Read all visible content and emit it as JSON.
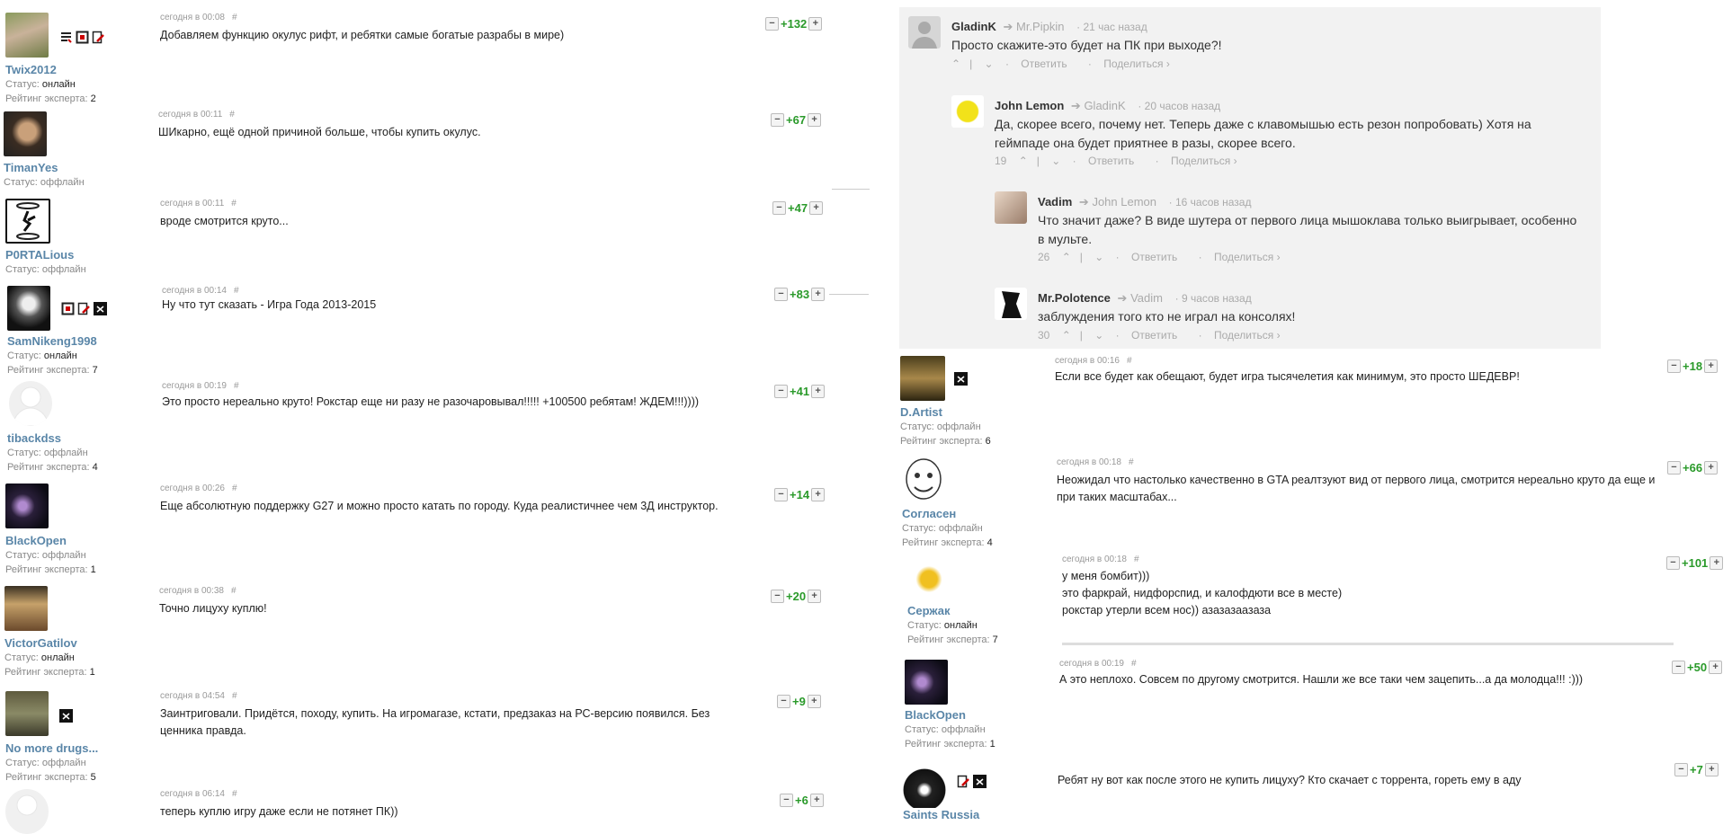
{
  "left_posts": [
    {
      "user": "Twix2012",
      "status_label": "Статус:",
      "status": "онлайн",
      "rating_label": "Рейтинг эксперта:",
      "rating": "2",
      "time": "сегодня в 00:08",
      "text": "Добавляем функцию окулус рифт, и ребятки самые богатые разрабы в мире)",
      "score": "+132"
    },
    {
      "user": "TimanYes",
      "status_label": "Статус:",
      "status": "оффлайн",
      "time": "сегодня в 00:11",
      "text": "ШИкарно, ещё одной причиной больше, чтобы купить окулус.",
      "score": "+67"
    },
    {
      "user": "P0RTALious",
      "status_label": "Статус:",
      "status": "оффлайн",
      "time": "сегодня в 00:11",
      "text": "вроде смотрится круто...",
      "score": "+47"
    },
    {
      "user": "SamNikeng1998",
      "status_label": "Статус:",
      "status": "онлайн",
      "rating_label": "Рейтинг эксперта:",
      "rating": "7",
      "time": "сегодня в 00:14",
      "text": "Ну что тут сказать - Игра Года 2013-2015",
      "score": "+83"
    },
    {
      "user": "tibackdss",
      "status_label": "Статус:",
      "status": "оффлайн",
      "rating_label": "Рейтинг эксперта:",
      "rating": "4",
      "time": "сегодня в 00:19",
      "text": "Это просто нереально круто! Рокстар еще ни разу не разочаровывал!!!!! +100500 ребятам! ЖДЕМ!!!))))",
      "score": "+41"
    },
    {
      "user": "BlackOpen",
      "status_label": "Статус:",
      "status": "оффлайн",
      "rating_label": "Рейтинг эксперта:",
      "rating": "1",
      "time": "сегодня в 00:26",
      "text": "Еще абсолютную поддержку G27 и можно просто катать по городу. Куда реалистичнее чем 3Д инструктор.",
      "score": "+14"
    },
    {
      "user": "VictorGatilov",
      "status_label": "Статус:",
      "status": "онлайн",
      "rating_label": "Рейтинг эксперта:",
      "rating": "1",
      "time": "сегодня в 00:38",
      "text": "Точно лицуху куплю!",
      "score": "+20"
    },
    {
      "user": "No more drugs...",
      "status_label": "Статус:",
      "status": "оффлайн",
      "rating_label": "Рейтинг эксперта:",
      "rating": "5",
      "time": "сегодня в 04:54",
      "text": "Заинтриговали. Придётся, походу, купить. На игромагазе, кстати, предзаказ на РС-версию появился. Без ценника правда.",
      "score": "+9"
    },
    {
      "time": "сегодня в 06:14",
      "text": "теперь куплю игру даже если не потянет ПК))",
      "score": "+6"
    }
  ],
  "hash": "#",
  "thread": [
    {
      "author": "GladinK",
      "reply_to": "Mr.Pipkin",
      "ago": "21 час назад",
      "text": "Просто скажите-это будет на ПК при выходе?!",
      "votes": "",
      "reply": "Ответить",
      "share": "Поделиться ›"
    },
    {
      "author": "John Lemon",
      "reply_to": "GladinK",
      "ago": "20 часов назад",
      "text": "Да, скорее всего, почему нет. Теперь даже с клавомышью есть резон попробовать) Хотя на геймпаде она будет приятнее в разы, скорее всего.",
      "votes": "19",
      "reply": "Ответить",
      "share": "Поделиться ›"
    },
    {
      "author": "Vadim",
      "reply_to": "John Lemon",
      "ago": "16 часов назад",
      "text": "Что значит даже? В виде шутера от первого лица мышоклава только выигрывает, особенно в мульте.",
      "votes": "26",
      "reply": "Ответить",
      "share": "Поделиться ›"
    },
    {
      "author": "Mr.Polotence",
      "reply_to": "Vadim",
      "ago": "9 часов назад",
      "text": "заблуждения того кто не играл на консолях!",
      "votes": "30",
      "reply": "Ответить",
      "share": "Поделиться ›"
    }
  ],
  "right_posts": [
    {
      "user": "D.Artist",
      "status_label": "Статус:",
      "status": "оффлайн",
      "rating_label": "Рейтинг эксперта:",
      "rating": "6",
      "time": "сегодня в 00:16",
      "text": "Если все будет как обещают, будет игра тысячелетия как минимум, это просто ШЕДЕВР!",
      "score": "+18"
    },
    {
      "user": "Согласен",
      "status_label": "Статус:",
      "status": "оффлайн",
      "rating_label": "Рейтинг эксперта:",
      "rating": "4",
      "time": "сегодня в 00:18",
      "text": "Неожидал что настолько качественно в GTA реалтзуют вид от первого лица, смотрится нереально круто да еще и при таких масштабах...",
      "score": "+66"
    },
    {
      "user": "Сержак",
      "status_label": "Статус:",
      "status": "онлайн",
      "rating_label": "Рейтинг эксперта:",
      "rating": "7",
      "time": "сегодня в 00:18",
      "text1": "у меня бомбит)))",
      "text2": "это фаркрай, нидфорспид, и калофдюти все в месте)",
      "text3": "рокстар утерли всем нос)) азазазаазаза",
      "score": "+101"
    },
    {
      "user": "BlackOpen",
      "status_label": "Статус:",
      "status": "оффлайн",
      "rating_label": "Рейтинг эксперта:",
      "rating": "1",
      "time": "сегодня в 00:19",
      "text": "А это неплохо. Совсем по другому смотрится. Нашли же все таки чем зацепить...а да молодца!!! :)))",
      "score": "+50"
    },
    {
      "user": "Saints Russia",
      "text": "Ребят ну вот как после этого не купить лицуху? Кто скачает с торрента, гореть ему в аду",
      "score": "+7"
    }
  ],
  "vote_minus": "−",
  "vote_plus": "+",
  "vote_up": "⌃",
  "vote_down": "⌄",
  "dot": "·",
  "arrow": "➔"
}
